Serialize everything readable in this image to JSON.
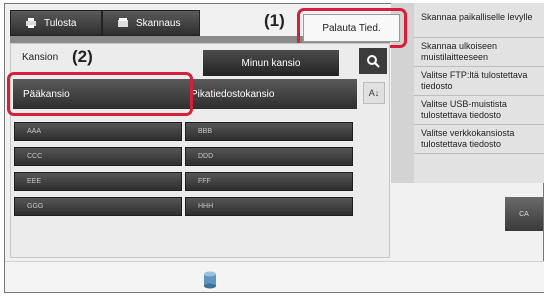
{
  "tabs": [
    {
      "label": "Tulosta",
      "icon": "print-icon"
    },
    {
      "label": "Skannaus",
      "icon": "scan-icon"
    }
  ],
  "callouts": [
    "(1)",
    "(2)"
  ],
  "header": {
    "restore_label": "Palauta Tied."
  },
  "folder": {
    "label": "Kansion",
    "my_folder": "Minun kansio",
    "main_folder": "Pääkansio",
    "quick_folder": "Pikatiedostokansio",
    "sort_label": "A↓"
  },
  "folders": [
    "AAA",
    "BBB",
    "CCC",
    "DDD",
    "EEE",
    "FFF",
    "GGG",
    "HHH"
  ],
  "actions": [
    "Skannaa paikalliselle levylle",
    "Skannaa ulkoiseen muistilaitteeseen",
    "Valitse FTP:ltä tulostettava tiedosto",
    "Valitse USB-muistista tulostettava tiedosto",
    "Valitse verkkokansiosta tulostettava tiedosto"
  ],
  "ca_label": "CA",
  "colors": {
    "highlight": "#d6203a",
    "button_dark": "#2e2e2e"
  }
}
